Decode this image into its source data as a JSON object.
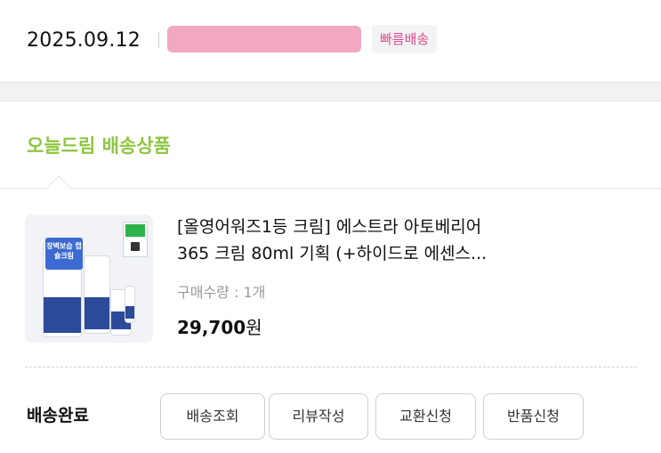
{
  "order": {
    "date": "2025.09.12",
    "badge": "빠름배송"
  },
  "delivery": {
    "title": "오늘드림 배송상품"
  },
  "product": {
    "name_line1": "[올영어워즈1등 크림] 에스트라 아토베리어",
    "name_line2": "365 크림 80ml 기획 (+하이드로 에센스...",
    "quantity": "구매수량 : 1개",
    "price_value": "29,700",
    "price_unit": "원",
    "thumb_tag": "장벽보습 캡슐크림"
  },
  "status": {
    "label": "배송완료"
  },
  "actions": {
    "track": "배송조회",
    "review": "리뷰작성",
    "exchange": "교환신청",
    "return": "반품신청"
  }
}
